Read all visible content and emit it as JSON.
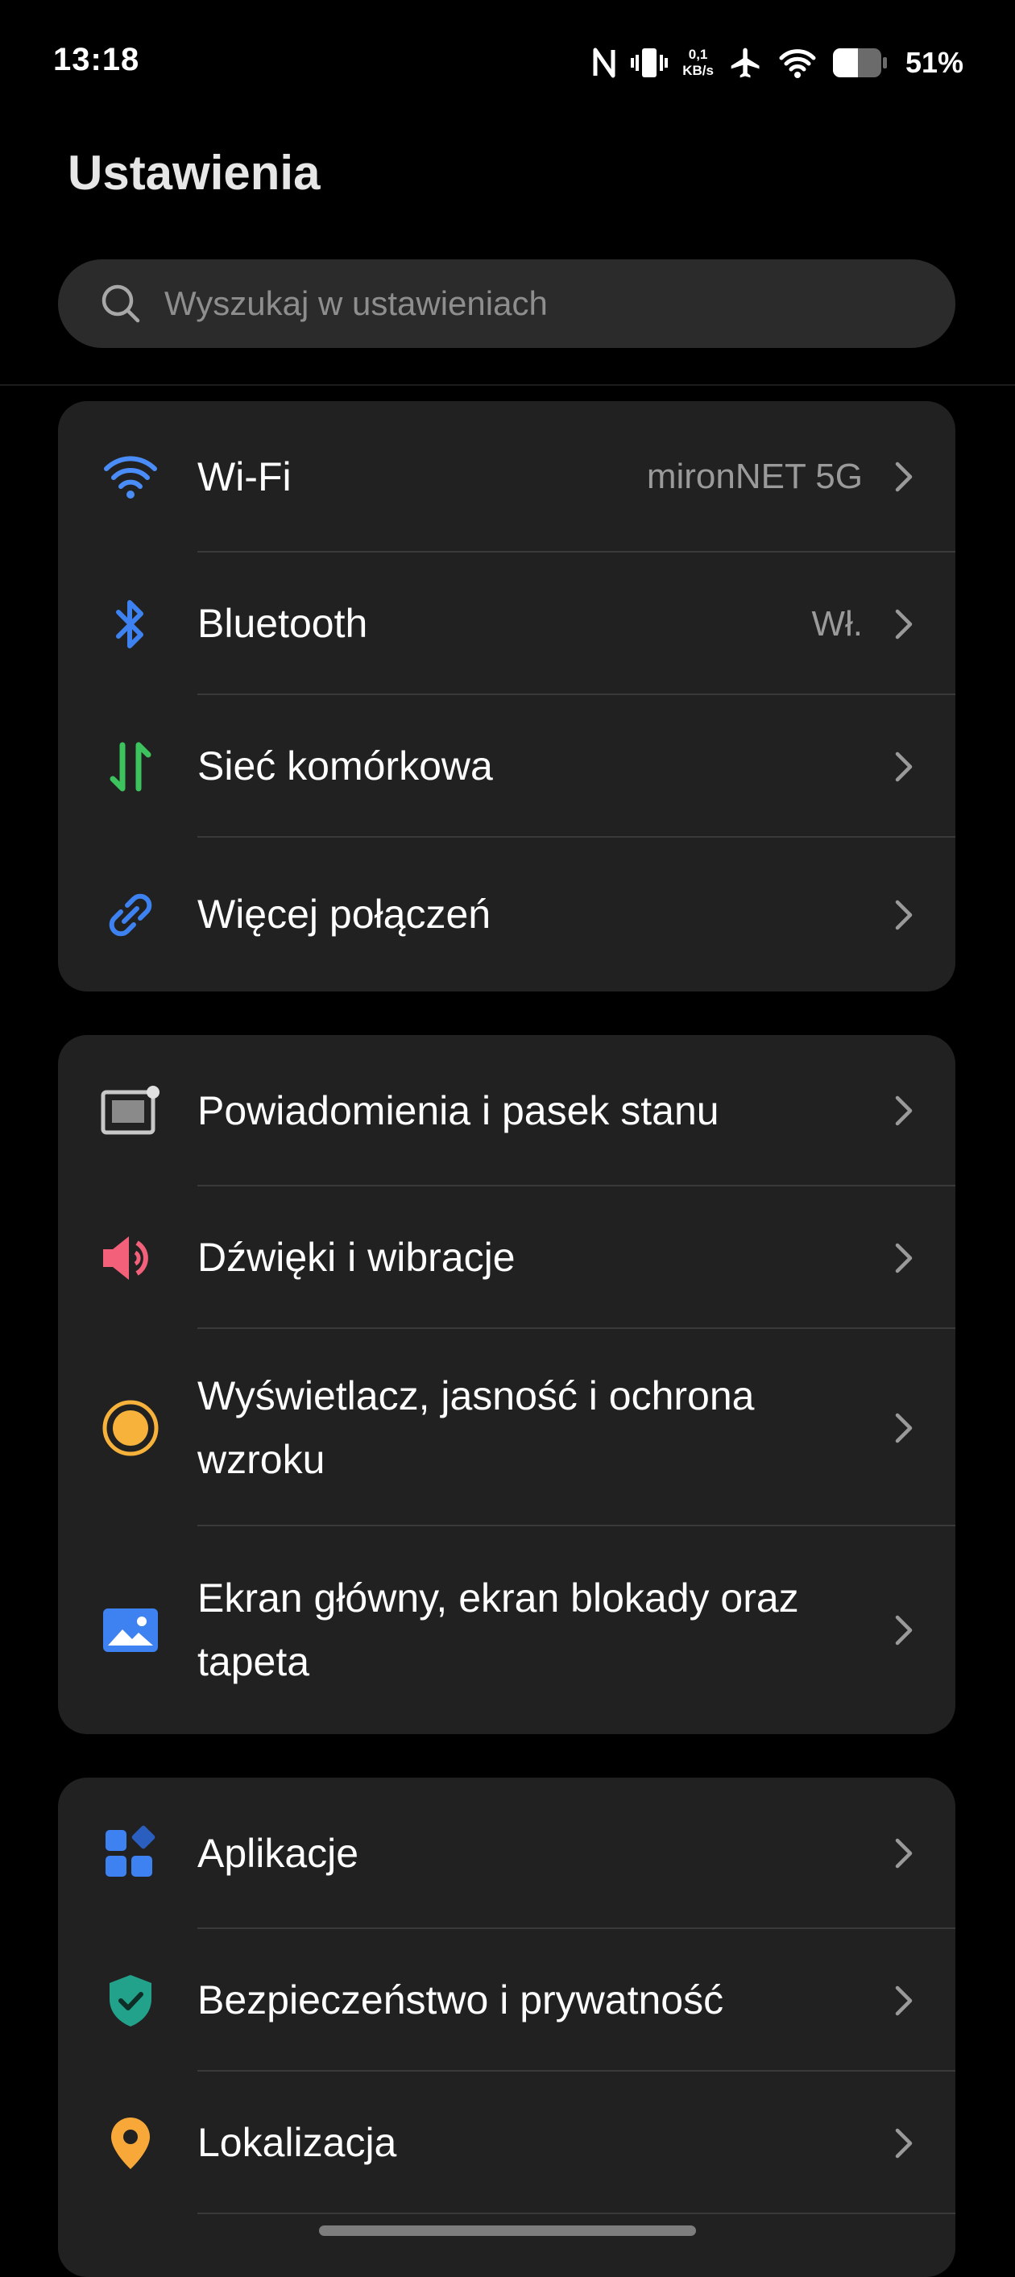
{
  "status_bar": {
    "time": "13:18",
    "net_speed_value": "0,1",
    "net_speed_unit": "KB/s",
    "battery_percent": "51%",
    "icons": [
      "nfc-icon",
      "vibrate-icon",
      "airplane-icon",
      "wifi-signal-icon",
      "battery-icon"
    ]
  },
  "page": {
    "title": "Ustawienia"
  },
  "search": {
    "placeholder": "Wyszukaj w ustawieniach"
  },
  "groups": [
    {
      "items": [
        {
          "label": "Wi-Fi",
          "value": "mironNET 5G",
          "icon": "wifi-icon",
          "color": "#4a8df8"
        },
        {
          "label": "Bluetooth",
          "value": "Wł.",
          "icon": "bluetooth-icon",
          "color": "#3d82f0"
        },
        {
          "label": "Sieć komórkowa",
          "value": "",
          "icon": "mobile-data-icon",
          "color": "#3cc35d"
        },
        {
          "label": "Więcej połączeń",
          "value": "",
          "icon": "link-icon",
          "color": "#3d82f0"
        }
      ]
    },
    {
      "items": [
        {
          "label": "Powiadomienia i pasek stanu",
          "icon": "notification-icon",
          "color": "#c8c8c8"
        },
        {
          "label": "Dźwięki i wibracje",
          "icon": "speaker-icon",
          "color": "#f2607a"
        },
        {
          "label": "Wyświetlacz, jasność i ochrona wzroku",
          "icon": "display-icon",
          "color": "#f7b23b"
        },
        {
          "label": "Ekran główny, ekran blokady oraz tapeta",
          "icon": "wallpaper-icon",
          "color": "#3d82f0"
        }
      ]
    },
    {
      "items": [
        {
          "label": "Aplikacje",
          "icon": "apps-icon",
          "color": "#3d82f0"
        },
        {
          "label": "Bezpieczeństwo i prywatność",
          "icon": "shield-icon",
          "color": "#22a28a"
        },
        {
          "label": "Lokalizacja",
          "icon": "location-icon",
          "color": "#f7a838"
        }
      ]
    }
  ]
}
